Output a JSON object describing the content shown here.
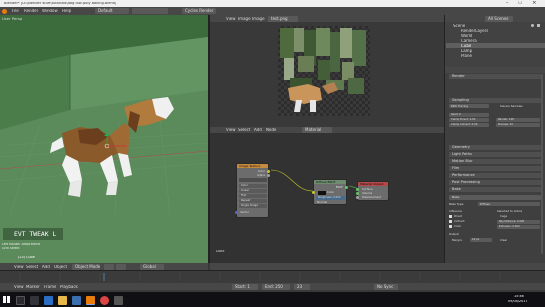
{
  "window": {
    "title": "Blender* [D:\\blender stuff\\tutorials\\dog low-poly baking.blend]",
    "controls": [
      "–",
      "□",
      "×"
    ]
  },
  "top_menu": [
    "File",
    "Render",
    "Window",
    "Help"
  ],
  "layout_label": "Default",
  "engine": "Cycles Render",
  "viewport": {
    "header_label": "User Persp",
    "overlay_text": "EVT_TWEAK_L",
    "hint_line_1": "Left Mouse: Add/Extend",
    "hint_line_2": "Grid Select",
    "object_label": "(23) Cube",
    "mode_label": "Object Mode",
    "menu": [
      "View",
      "Select",
      "Add",
      "Object"
    ],
    "shading": "Global"
  },
  "image_editor": {
    "image_name": "test.png",
    "menu": [
      "View",
      "Image",
      "Image"
    ]
  },
  "node_editor": {
    "menu": [
      "View",
      "Select",
      "Add",
      "Node"
    ],
    "material_name": "Material",
    "footer_label": "Dock",
    "nodes": {
      "image_texture": {
        "title": "Image Texture",
        "outputs": [
          "Color",
          "Alpha"
        ],
        "fields": [
          "Color",
          "Linear",
          "Flat",
          "Repeat",
          "Single Image"
        ],
        "vector_label": "Vector"
      },
      "diffuse": {
        "title": "Diffuse BSDF",
        "output": "BSDF",
        "fields": [
          "Color",
          "Roughness: 0.000",
          "Normal"
        ]
      },
      "material_output": {
        "title": "Material Output",
        "inputs": [
          "Surface",
          "Volume",
          "Displacement"
        ]
      }
    }
  },
  "outliner": {
    "search_label": "All Scenes",
    "items": [
      "Scene",
      "RenderLayers",
      "World",
      "Camera",
      "Cube",
      "Lamp",
      "Plane"
    ]
  },
  "properties": {
    "sections": [
      "Render",
      "Sampling",
      "Geometry",
      "Light Paths",
      "Motion Blur",
      "Film",
      "Performance",
      "Post Processing",
      "Bake"
    ],
    "bake": {
      "type_label": "Bake Type:",
      "type_value": "Diffuse",
      "selected_to_active": "Selected to Active",
      "cage": "Cage",
      "ray_distance": "Ray Distance: 0.000",
      "extrusion": "Extrusion: 0.000",
      "influence_label": "Influence",
      "checks": [
        "Direct",
        "Indirect",
        "Color"
      ],
      "margin_label": "Margin:",
      "margin_value": "16 px",
      "clear_label": "Clear",
      "output_label": "Output"
    },
    "sampling": {
      "preset": "Path Tracing",
      "square_samples": "Square Samples",
      "seed": "Seed: 0",
      "clamp_direct": "Clamp Direct: 0.00",
      "clamp_indirect": "Clamp Indirect: 0.00",
      "render": "Render: 128",
      "preview": "Preview: 32"
    },
    "button_bake": "Bake"
  },
  "timeline": {
    "menu": [
      "View",
      "Marker",
      "Frame",
      "Playback"
    ],
    "start": "Start: 1",
    "end": "End: 250",
    "current": "23",
    "sync": "No Sync"
  },
  "taskbar": {
    "time": "15:46",
    "date": "09/04/2017"
  }
}
